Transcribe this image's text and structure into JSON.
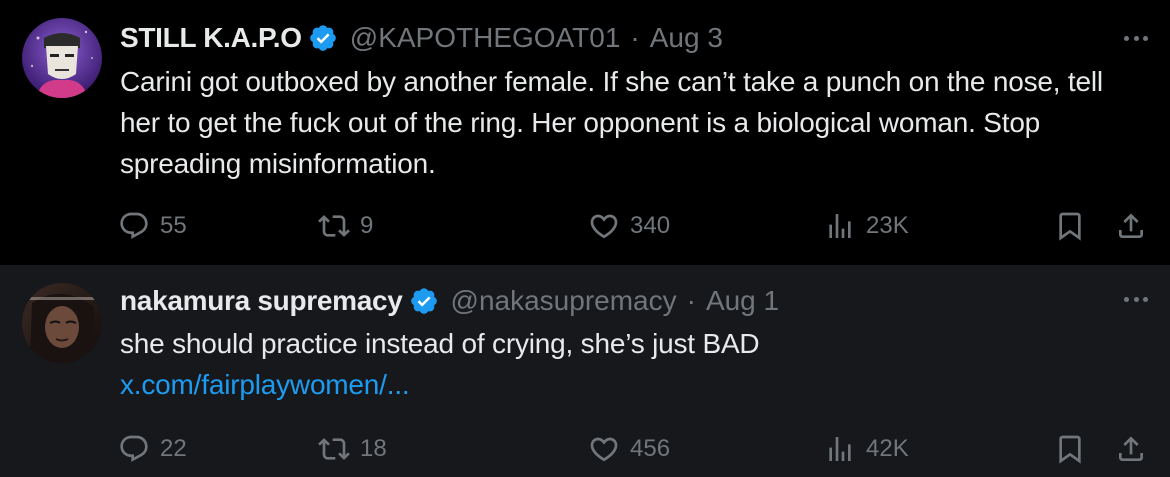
{
  "colors": {
    "background": "#000000",
    "highlight_row": "#16181c",
    "text": "#e7e9ea",
    "muted": "#71767b",
    "link": "#1d9bf0",
    "verified": "#1d9bf0"
  },
  "tweets": [
    {
      "display_name": "STILL K.A.P.O",
      "handle": "@KAPOTHEGOAT01",
      "separator": "·",
      "date": "Aug 3",
      "verified_icon": "verified-badge-icon",
      "text": "Carini got outboxed by another female. If she can’t take a punch on the nose, tell her to get the fuck out of the ring. Her opponent is a biological woman. Stop spreading misinformation.",
      "link": "",
      "replies": "55",
      "reposts": "9",
      "likes": "340",
      "views": "23K"
    },
    {
      "display_name": "nakamura supremacy",
      "handle": "@nakasupremacy",
      "separator": "·",
      "date": "Aug 1",
      "verified_icon": "verified-badge-icon",
      "text": "she should practice instead of crying, she’s just BAD",
      "link": "x.com/fairplaywomen/...",
      "replies": "22",
      "reposts": "18",
      "likes": "456",
      "views": "42K"
    }
  ]
}
